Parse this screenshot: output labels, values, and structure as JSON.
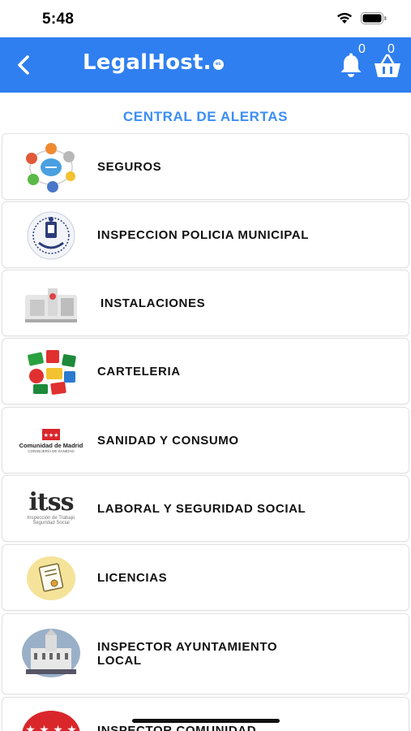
{
  "status_bar": {
    "time": "5:48"
  },
  "app_bar": {
    "title": "LegalHost",
    "title_suffix": ".",
    "tld_badge": "es",
    "notifications_count": "0",
    "cart_count": "0",
    "background": "#2f7ff0"
  },
  "section_title": "CENTRAL DE ALERTAS",
  "alerts": [
    {
      "label": "SEGUROS",
      "icon": "insurance-network-icon"
    },
    {
      "label": "INSPECCION POLICIA MUNICIPAL",
      "icon": "municipal-police-seal-icon"
    },
    {
      "label": "INSTALACIONES",
      "icon": "installations-machinery-icon"
    },
    {
      "label": "CARTELERIA",
      "icon": "signage-icon"
    },
    {
      "label": "SANIDAD Y CONSUMO",
      "icon": "comunidad-madrid-logo-icon",
      "logo_text": "Comunidad de Madrid",
      "logo_subtext": "CONSEJERÍA DE SANIDAD"
    },
    {
      "label": "LABORAL Y SEGURIDAD SOCIAL",
      "icon": "itss-logo-icon",
      "logo_text": "itss",
      "logo_subtext": "Inspección de Trabajo",
      "logo_subtext2": "Seguridad Social"
    },
    {
      "label": "LICENCIAS",
      "icon": "license-certificate-icon"
    },
    {
      "label": "INSPECTOR AYUNTAMIENTO",
      "label_line2": "LOCAL",
      "icon": "city-hall-building-icon"
    },
    {
      "label": "INSPECTOR COMUNIDAD",
      "icon": "madrid-flag-icon"
    }
  ]
}
